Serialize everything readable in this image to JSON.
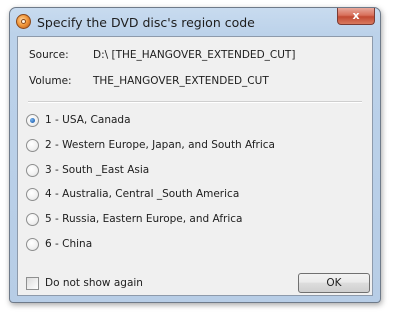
{
  "window": {
    "title": "Specify the DVD disc's region code",
    "close_glyph": "x",
    "icon": "dvd-disc-icon"
  },
  "info": {
    "source_label": "Source:",
    "source_value": "D:\\ [THE_HANGOVER_EXTENDED_CUT]",
    "volume_label": "Volume:",
    "volume_value": "THE_HANGOVER_EXTENDED_CUT"
  },
  "regions": [
    {
      "label": "1 - USA, Canada",
      "selected": true
    },
    {
      "label": "2 - Western Europe, Japan, and South Africa",
      "selected": false
    },
    {
      "label": "3 - South _East Asia",
      "selected": false
    },
    {
      "label": "4 - Australia, Central _South America",
      "selected": false
    },
    {
      "label": "5 - Russia, Eastern Europe, and Africa",
      "selected": false
    },
    {
      "label": "6 - China",
      "selected": false
    }
  ],
  "footer": {
    "do_not_show_label": "Do not show again",
    "do_not_show_checked": false,
    "ok_label": "OK"
  },
  "colors": {
    "titlebar": "#bcd2ea",
    "client_bg": "#f0f0f0",
    "close_button": "#c24a33",
    "radio_selected": "#1e5fb0"
  }
}
